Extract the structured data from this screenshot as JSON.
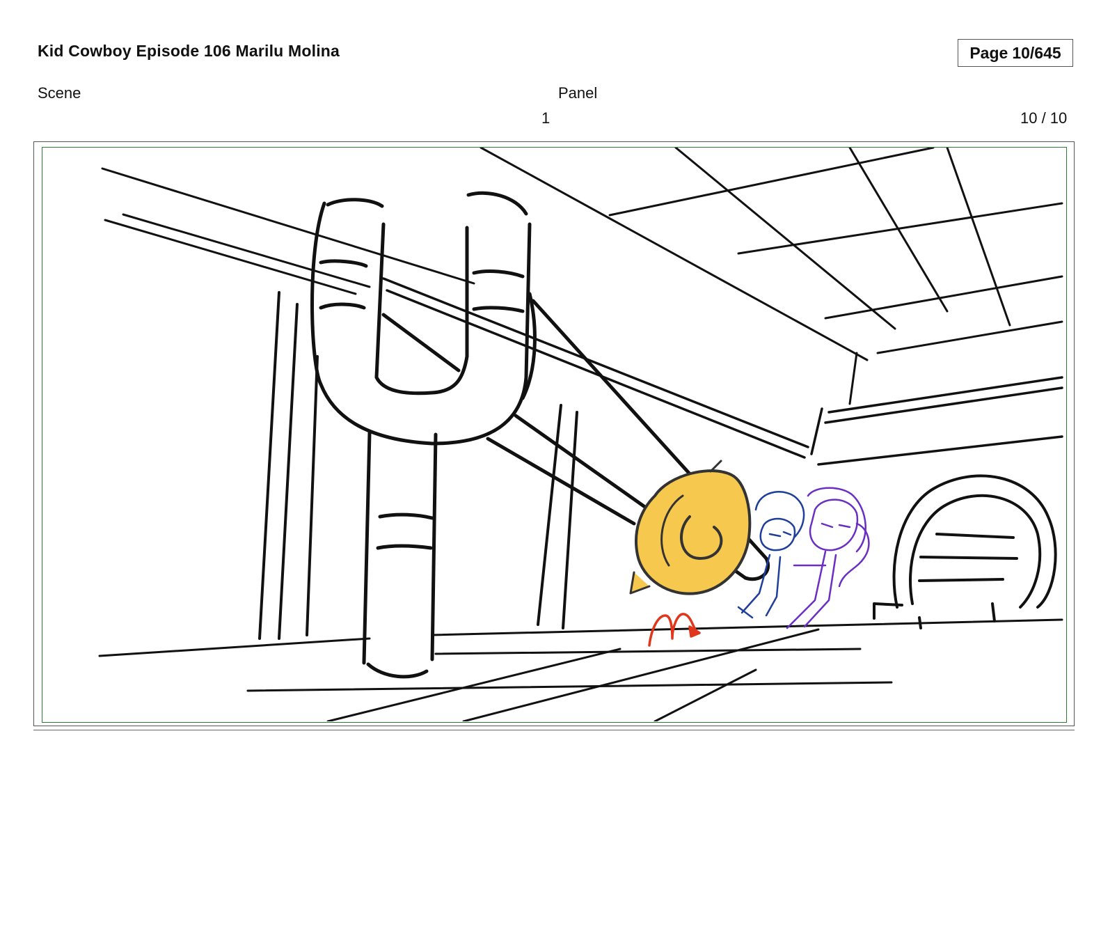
{
  "header": {
    "title": "Kid Cowboy Episode 106 Marilu Molina",
    "page_label": "Page",
    "page_number": "10/645"
  },
  "fields": {
    "scene_label": "Scene",
    "panel_label": "Panel",
    "scene_value": "1",
    "panel_value": "10 / 10"
  },
  "colors": {
    "frame_border": "#2e7d32",
    "ink": "#111111",
    "yellow_fill": "#f6c94e",
    "blue_character": "#1f3e9a",
    "purple_character": "#6a2fc2",
    "red_motion": "#e0361c"
  }
}
